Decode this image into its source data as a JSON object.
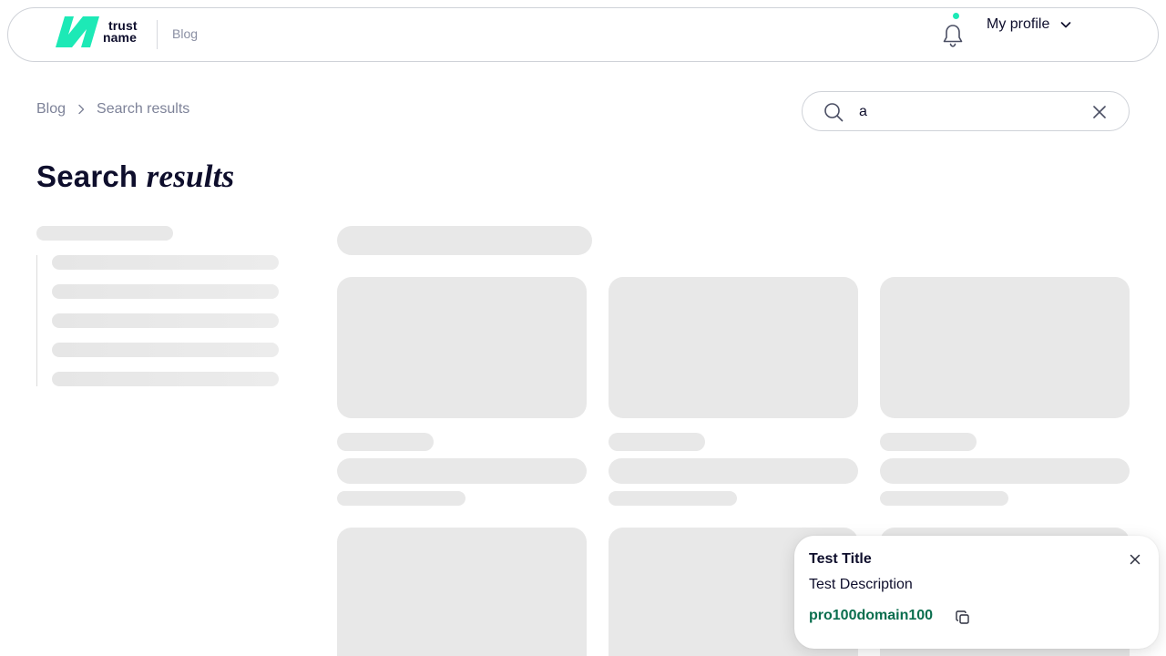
{
  "header": {
    "logo": {
      "line1": "trust",
      "line2": "name"
    },
    "blog_link": "Blog",
    "notification_badge_color": "#1de9b6",
    "profile_label": "My profile"
  },
  "breadcrumb": {
    "items": [
      "Blog",
      "Search results"
    ]
  },
  "search": {
    "value": "a"
  },
  "page_title": {
    "main": "Search",
    "emphasis": "results"
  },
  "toast": {
    "title": "Test Title",
    "description": "Test Description",
    "domain": "pro100domain100"
  },
  "colors": {
    "brand": "#1de9b6",
    "domain_text": "#0a6e4e",
    "skeleton": "#e8e8e8",
    "muted_text": "#7d8298"
  },
  "icons": [
    "trustname-logo-icon",
    "bell-icon",
    "chevron-down-icon",
    "chevron-right-icon",
    "search-icon",
    "close-icon",
    "copy-icon"
  ]
}
